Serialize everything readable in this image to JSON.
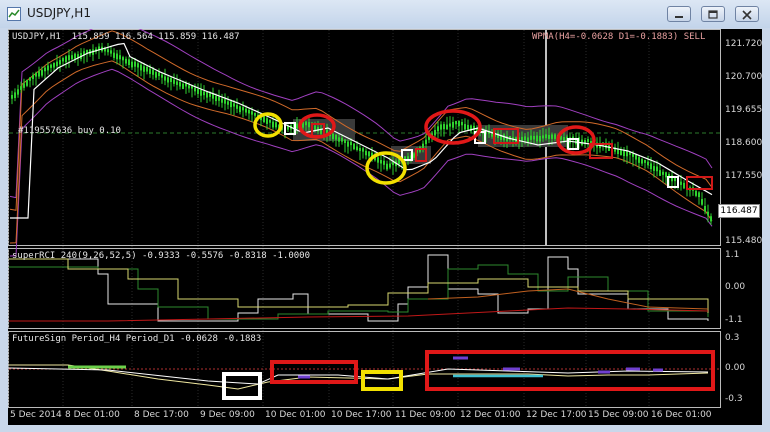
{
  "window": {
    "title": "USDJPY,H1"
  },
  "main_panel": {
    "header": "USDJPY,H1  115.859 116.564 115.859 116.487",
    "indicator_text": "WPMA(H4=-0.0628 D1=-0.1883) SELL",
    "order_label": "#119557636 buy 0.10",
    "price_labels": [
      "121.720",
      "120.700",
      "119.655",
      "118.600",
      "117.550",
      "115.480"
    ],
    "current_price": "116.487"
  },
  "rci_panel": {
    "header": "superRCI 240(9,26,52,5) -0.9333 -0.5576 -0.8318 -1.0000",
    "scale": [
      "1.1",
      "0.00",
      "-1.1"
    ]
  },
  "fs_panel": {
    "header": "FutureSign Period_H4 Period_D1 -0.0628 -0.1883",
    "scale": [
      "0.3",
      "0.00",
      "-0.3"
    ]
  },
  "time_axis": [
    "5 Dec 2014",
    "8 Dec 01:00",
    "8 Dec 17:00",
    "9 Dec 09:00",
    "10 Dec 01:00",
    "10 Dec 17:00",
    "11 Dec 09:00",
    "12 Dec 01:00",
    "12 Dec 17:00",
    "15 Dec 09:00",
    "16 Dec 01:00"
  ],
  "colors": {
    "candles": "#2fd12f",
    "bands_outer": "#a040c0",
    "bands_inner": "#d06a2a",
    "ma": "#ffffff",
    "highlight_red": "#e01818",
    "highlight_yellow": "#f2e000",
    "highlight_white": "#ffffff"
  }
}
